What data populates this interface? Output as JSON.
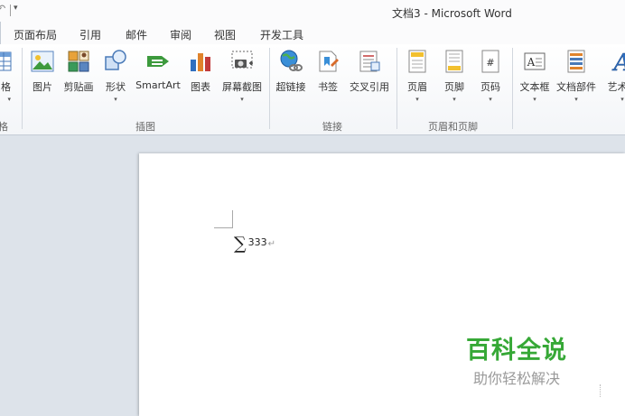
{
  "window": {
    "title": "文档3 - Microsoft Word"
  },
  "quick_access": {
    "dropdown_glyph": "▾"
  },
  "tabs": [
    "页面布局",
    "引用",
    "邮件",
    "审阅",
    "视图",
    "开发工具"
  ],
  "ribbon": {
    "groups": [
      {
        "label": "格",
        "buttons": [
          {
            "label": "格",
            "icon": "table-icon",
            "dropdown": true
          }
        ]
      },
      {
        "label": "插图",
        "buttons": [
          {
            "label": "图片",
            "icon": "picture-icon",
            "dropdown": false
          },
          {
            "label": "剪贴画",
            "icon": "clipart-icon",
            "dropdown": false
          },
          {
            "label": "形状",
            "icon": "shapes-icon",
            "dropdown": true
          },
          {
            "label": "SmartArt",
            "icon": "smartart-icon",
            "dropdown": false
          },
          {
            "label": "图表",
            "icon": "chart-icon",
            "dropdown": false
          },
          {
            "label": "屏幕截图",
            "icon": "screenshot-icon",
            "dropdown": true
          }
        ]
      },
      {
        "label": "链接",
        "buttons": [
          {
            "label": "超链接",
            "icon": "hyperlink-icon",
            "dropdown": false
          },
          {
            "label": "书签",
            "icon": "bookmark-icon",
            "dropdown": false
          },
          {
            "label": "交叉引用",
            "icon": "cross-reference-icon",
            "dropdown": false
          }
        ]
      },
      {
        "label": "页眉和页脚",
        "buttons": [
          {
            "label": "页眉",
            "icon": "header-icon",
            "dropdown": true
          },
          {
            "label": "页脚",
            "icon": "footer-icon",
            "dropdown": true
          },
          {
            "label": "页码",
            "icon": "page-number-icon",
            "dropdown": true
          }
        ]
      },
      {
        "label": "",
        "buttons": [
          {
            "label": "文本框",
            "icon": "textbox-icon",
            "dropdown": true
          },
          {
            "label": "文档部件",
            "icon": "quick-parts-icon",
            "dropdown": true
          },
          {
            "label": "艺术字",
            "icon": "wordart-icon",
            "dropdown": true
          }
        ]
      }
    ]
  },
  "document": {
    "equation_symbol": "∑",
    "equation_value": "333",
    "paragraph_mark": "↵"
  },
  "watermark": {
    "main": "百科全说",
    "sub": "助你轻松解决"
  },
  "colors": {
    "watermark_green": "#36a836",
    "link_blue": "#1a6fc4"
  }
}
